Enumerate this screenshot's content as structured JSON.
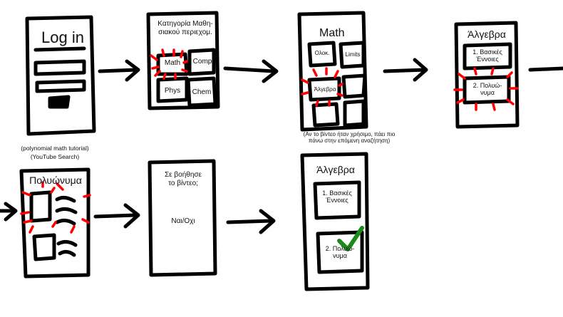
{
  "screens": {
    "login": {
      "title": "Log in"
    },
    "categories": {
      "title": "Κατηγορία Μαθη-\nσιακού περιεχομ.",
      "items": [
        "Math",
        "Comp",
        "Phys",
        "Chem"
      ]
    },
    "math": {
      "title": "Math",
      "items": [
        "Ολοκ.",
        "Limits",
        "Άλγεβρα"
      ]
    },
    "algebra": {
      "title": "Άλγεβρα",
      "items": [
        "1. Βασικές\nΈννοιες",
        "2. Πολυώ-\nνυμα"
      ]
    },
    "polynomials": {
      "title": "Πολυώνυμα",
      "caption_1": "(polynomial math tutorial)",
      "caption_2": "(YouTube Search)"
    },
    "feedback": {
      "question": "Σε βοήθησε\nτο βίντεο;",
      "answer": "Ναι/Οχι"
    },
    "algebra_done": {
      "title": "Άλγεβρα",
      "items": [
        "1. Βασικές\nΈννοιες",
        "2. Πολυώ-\nνυμα"
      ],
      "note": "(Αν το βίντεο ήταν χρήσιμο, πάει πιο\nπάνω στην επόμενη αναζήτηση)"
    }
  },
  "colors": {
    "ink": "#000000",
    "highlight": "#ff0000",
    "check": "#1a8a1a"
  }
}
